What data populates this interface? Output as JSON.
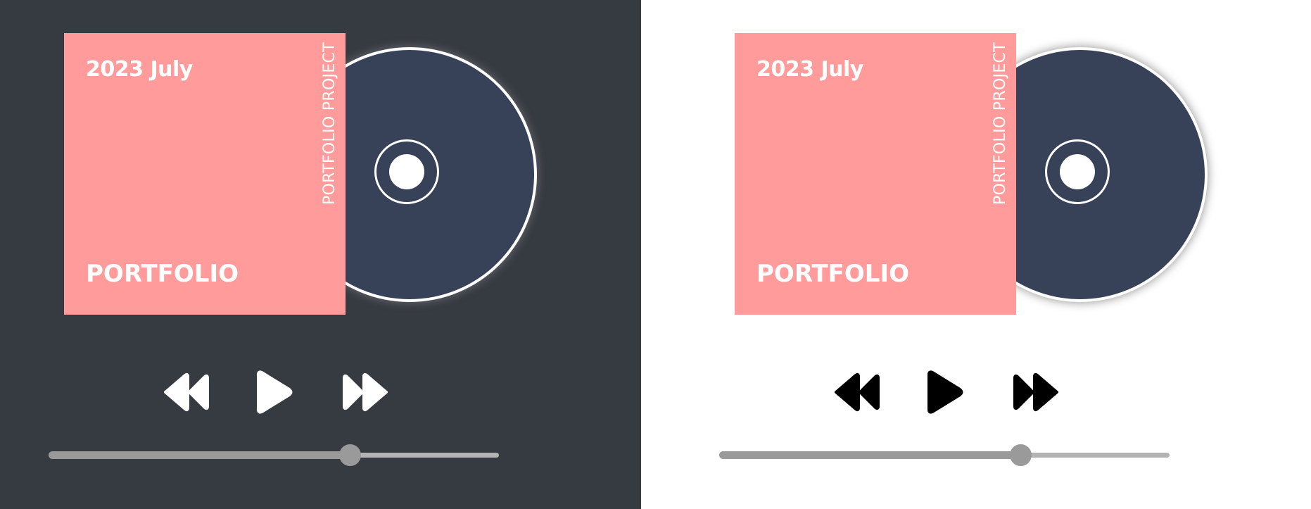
{
  "album": {
    "date": "2023 July",
    "title": "PORTFOLIO",
    "side_text": "PORTFOLIO PROJECT"
  },
  "player": {
    "progress": 0.67
  },
  "icons": {
    "previous": "rewind-icon",
    "play": "play-icon",
    "next": "fast-forward-icon"
  },
  "colors": {
    "dark_background": "#363a41",
    "light_background": "#ffffff",
    "cover": "#ff9b9b",
    "disc": "#374259",
    "controls_dark_theme": "#ffffff",
    "controls_light_theme": "#000000",
    "progress": "#9a9a9a"
  }
}
